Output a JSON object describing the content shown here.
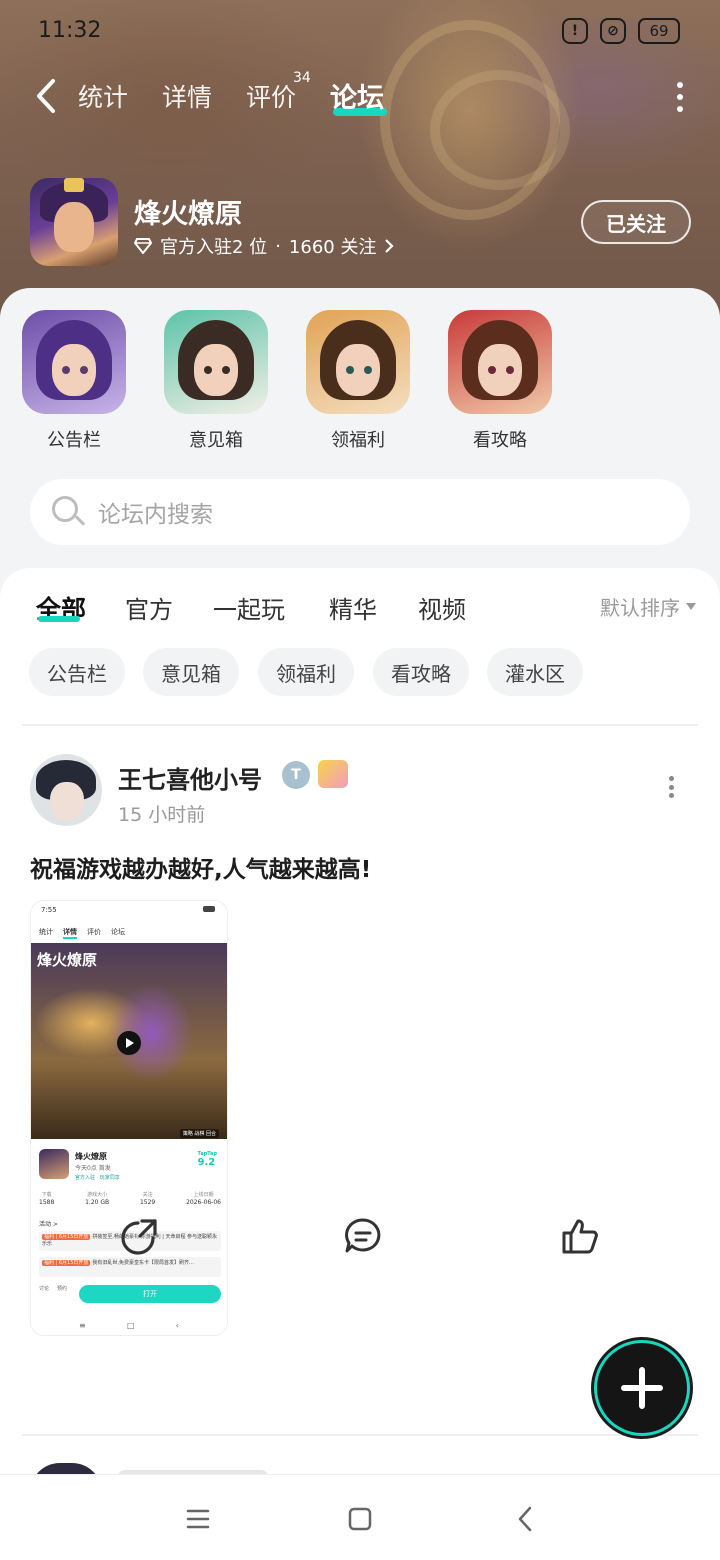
{
  "status_bar": {
    "time": "11:32",
    "battery": "69"
  },
  "nav": {
    "tabs": [
      {
        "label": "统计"
      },
      {
        "label": "详情"
      },
      {
        "label": "评价",
        "count": "34"
      },
      {
        "label": "论坛",
        "active": true
      }
    ]
  },
  "game": {
    "title": "烽火燎原",
    "meta_rank": "官方入驻2 位",
    "meta_dot": "·",
    "meta_followers": "1660 关注",
    "follow_label": "已关注"
  },
  "quick_links": [
    {
      "label": "公告栏"
    },
    {
      "label": "意见箱"
    },
    {
      "label": "领福利"
    },
    {
      "label": "看攻略"
    }
  ],
  "search": {
    "placeholder": "论坛内搜索"
  },
  "filters": {
    "tabs": [
      "全部",
      "官方",
      "一起玩",
      "精华",
      "视频"
    ],
    "sort_label": "默认排序",
    "chips": [
      "公告栏",
      "意见箱",
      "领福利",
      "看攻略",
      "灌水区"
    ]
  },
  "post": {
    "author": "王七喜他小号",
    "badge_text": "T",
    "time": "15 小时前",
    "text": "祝福游戏越办越好,人气越来越高!",
    "screenshot": {
      "time": "7:55",
      "tabs": [
        "统计",
        "详情",
        "评价",
        "论坛"
      ],
      "brand": "烽火燎原",
      "tags": "策略 战棋 回合",
      "title": "烽火燎原",
      "subtitle": "今天0点 首发",
      "subtitle2": "官方入驻 · 玩家同享",
      "score_brand": "TapTap",
      "score": "9.2",
      "stats": [
        {
          "label": "下载",
          "value": "1588"
        },
        {
          "label": "游戏大小",
          "value": "1.20 GB"
        },
        {
          "label": "关注",
          "value": "1529"
        },
        {
          "label": "上线日期",
          "value": "2026-06-06"
        }
      ],
      "activity_header": "活动 >",
      "activities": [
        {
          "tag": "福利 | 6月15日开放",
          "text": "拼装签至,畅的她豪礼 你游福利 | 天命启程 参与送聪颖永乐乐"
        },
        {
          "tag": "福利 | 6月15日开放",
          "text": "我有旧乱世,免费豪皇东卡【限局首发】刷齐..."
        }
      ],
      "bottom_left": "讨论",
      "bottom_right": "预约",
      "open_label": "打开",
      "sysnav": [
        "≡",
        "□",
        "‹"
      ]
    }
  },
  "colors": {
    "accent": "#19d6c0",
    "fab_bg": "#151515"
  },
  "icons": [
    "back-icon",
    "more-vertical-icon",
    "diamond-icon",
    "chevron-right-icon",
    "search-icon",
    "share-icon",
    "comment-icon",
    "like-icon",
    "plus-icon",
    "menu-icon",
    "home-icon",
    "back-nav-icon"
  ]
}
